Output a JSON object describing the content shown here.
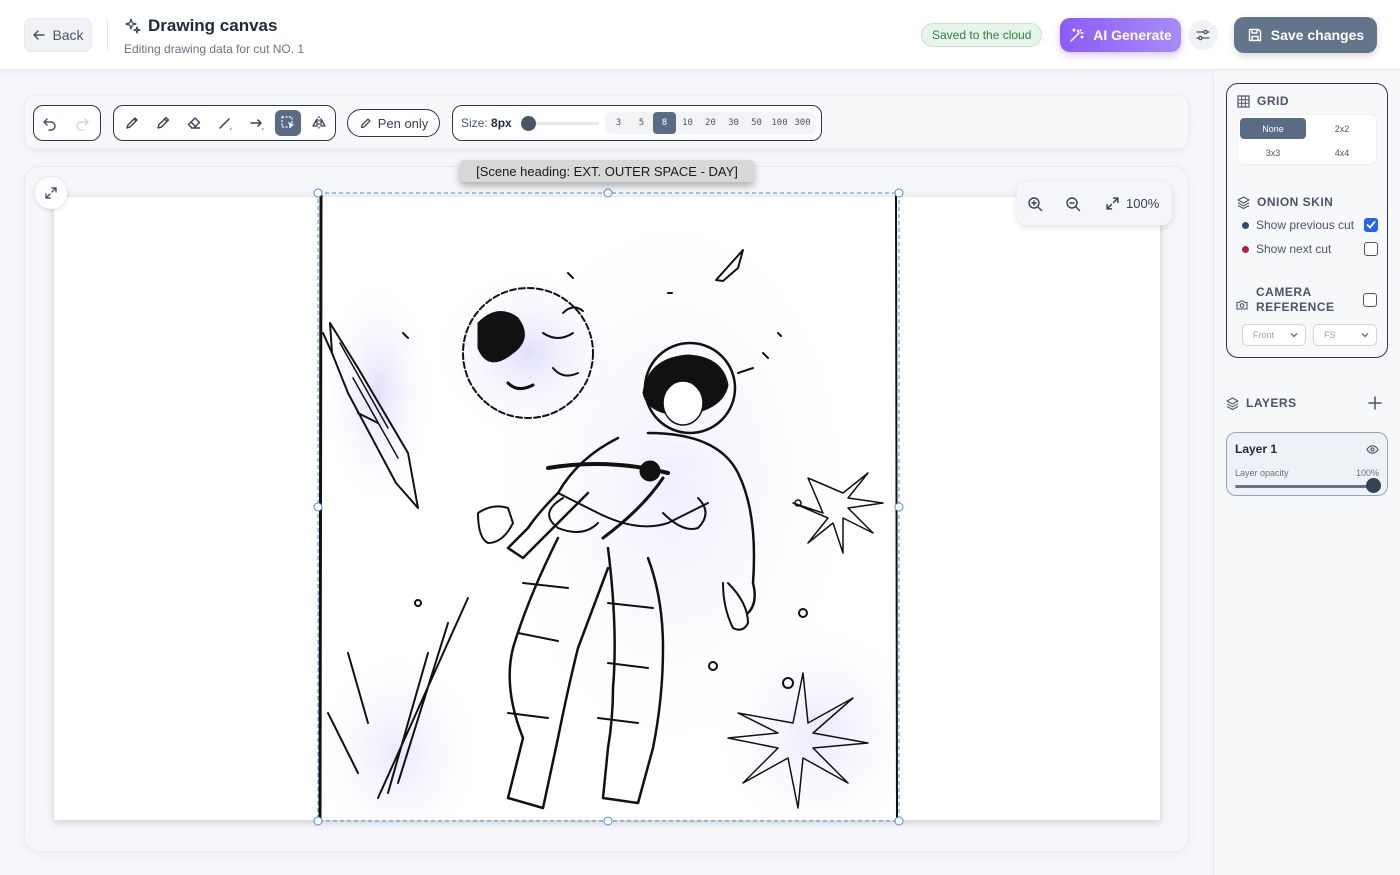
{
  "header": {
    "back_label": "Back",
    "title": "Drawing canvas",
    "subtitle": "Editing drawing data for cut NO. 1",
    "saved_status": "Saved to the cloud",
    "ai_generate_label": "AI Generate",
    "save_label": "Save changes"
  },
  "toolbar": {
    "history_tools": [
      "undo-icon",
      "redo-icon"
    ],
    "draw_tools": [
      "pen-icon",
      "pencil-icon",
      "eraser-icon",
      "line-icon",
      "arrow-icon",
      "select-icon",
      "mirror-icon"
    ],
    "active_tool": "select-icon",
    "pen_only_label": "Pen only",
    "size_label": "Size:",
    "size_value": "8px",
    "size_slider": {
      "min": 1,
      "max": 300,
      "value": 8
    },
    "size_presets": [
      "3",
      "5",
      "8",
      "10",
      "20",
      "30",
      "50",
      "100",
      "300"
    ],
    "active_preset": "8"
  },
  "canvas": {
    "scene_label": "[Scene heading: EXT. OUTER SPACE - DAY]",
    "zoom_value": "100%"
  },
  "grid": {
    "title": "GRID",
    "options": [
      "None",
      "2x2",
      "3x3",
      "4x4"
    ],
    "selected": "None"
  },
  "onion_skin": {
    "title": "ONION SKIN",
    "previous": {
      "label": "Show previous cut",
      "checked": true,
      "color": "#2d4a7a"
    },
    "next": {
      "label": "Show next cut",
      "checked": false,
      "color": "#b0233c"
    }
  },
  "camera": {
    "title_line1": "CAMERA",
    "title_line2": "REFERENCE",
    "checked": false,
    "angle": "Front",
    "shot": "FS"
  },
  "layers": {
    "title": "LAYERS",
    "items": [
      {
        "name": "Layer 1",
        "opacity_label": "Layer opacity",
        "opacity_value": "100%",
        "opacity": 1.0
      }
    ]
  },
  "colors": {
    "accent": "#8b5cf6",
    "primary": "#64748b",
    "active_tool": "#5a6b85",
    "saved_green": "#2f7d4a"
  }
}
